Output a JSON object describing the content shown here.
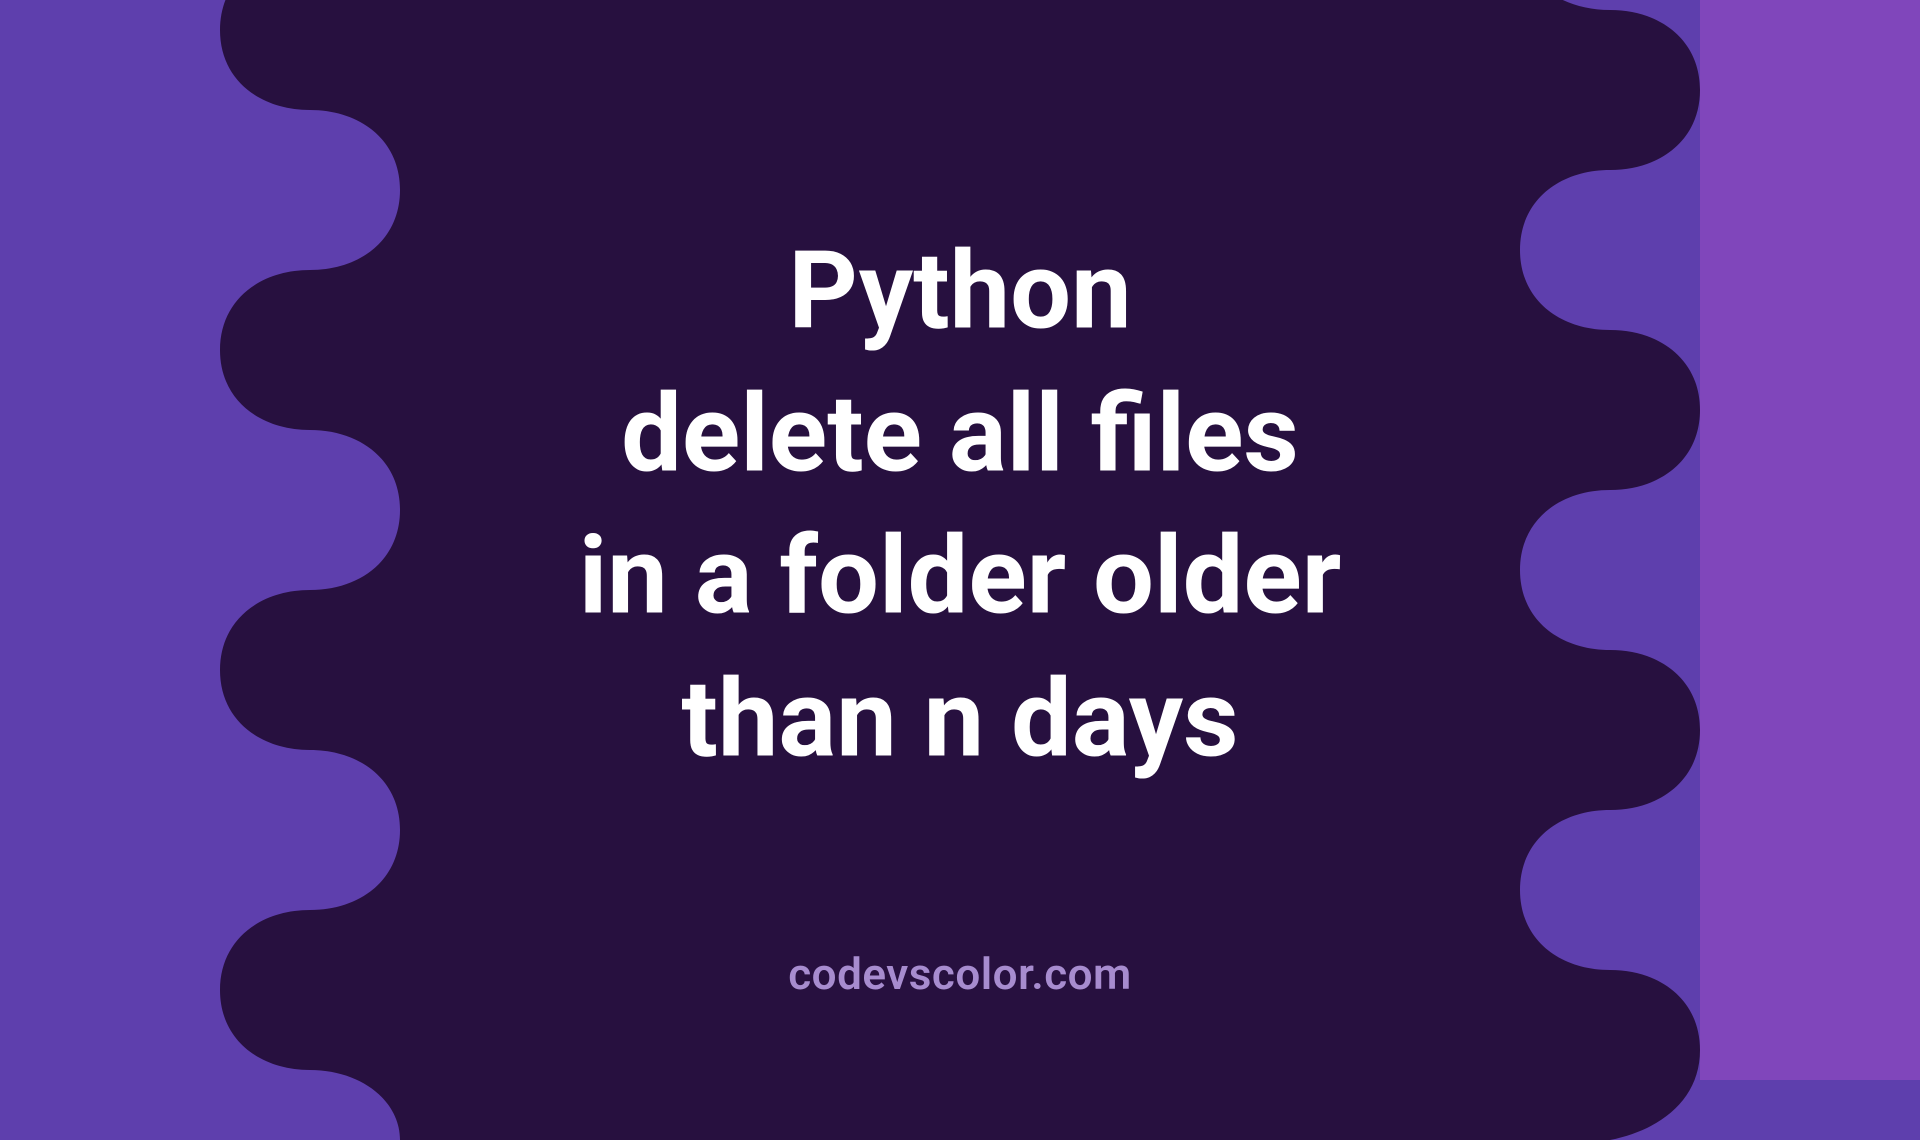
{
  "title": {
    "line1": "Python",
    "line2": "delete all files",
    "line3": "in a folder older",
    "line4": "than n days"
  },
  "watermark": "codevscolor.com",
  "colors": {
    "bg_left": "#5e3fad",
    "bg_right": "#8046bb",
    "blob": "#27103f",
    "text": "#ffffff",
    "watermark": "#a78ccf"
  }
}
